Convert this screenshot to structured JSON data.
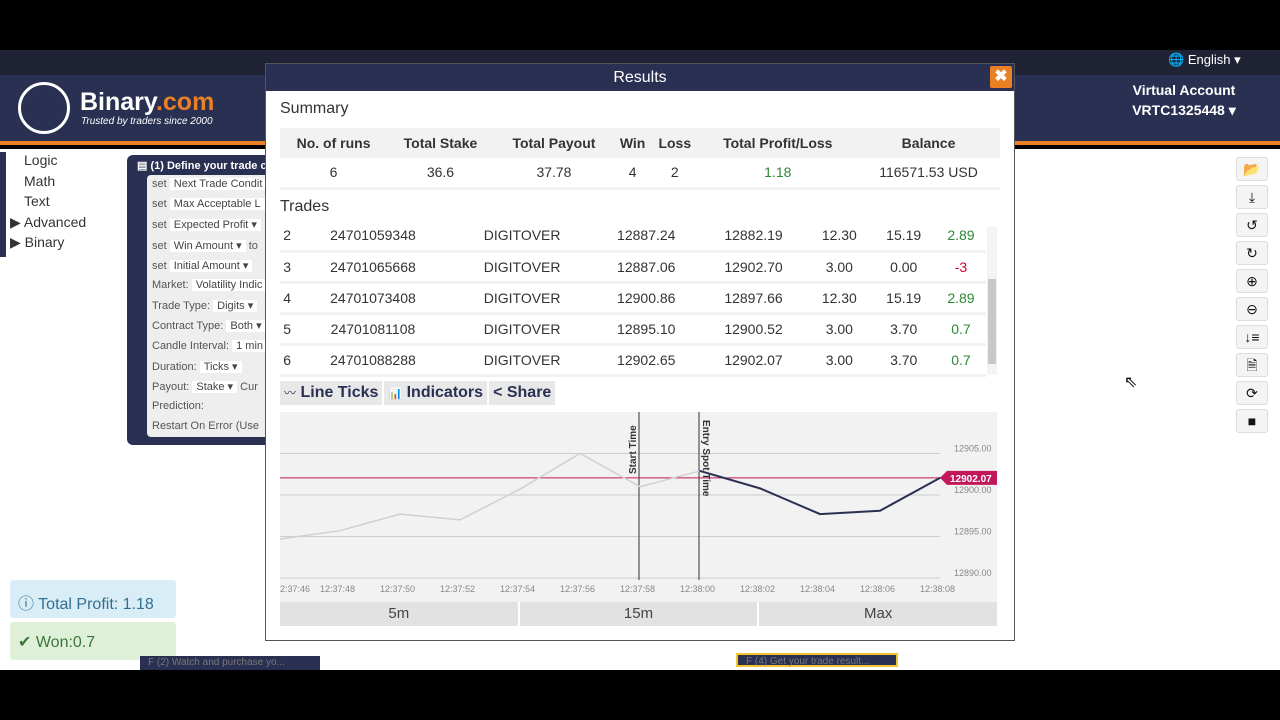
{
  "header": {
    "brand_main": "Binary",
    "brand_accent": ".com",
    "tagline": "Trusted by traders since 2000",
    "language": "English",
    "account_type": "Virtual Account",
    "account_id": "VRTC1325448"
  },
  "toolbox": {
    "items": [
      "Logic",
      "Math",
      "Text",
      "Advanced",
      "Binary"
    ]
  },
  "block": {
    "title": "(1) Define your trade c",
    "rows": [
      [
        "set",
        "Next Trade Condit"
      ],
      [
        "set",
        "Max Acceptable L"
      ],
      [
        "set",
        "Expected Profit ▾"
      ],
      [
        "set",
        "Win Amount ▾",
        "to"
      ],
      [
        "set",
        "Initial Amount ▾"
      ],
      [
        "Market:",
        "Volatility Indic"
      ],
      [
        "Trade Type:",
        "Digits ▾"
      ],
      [
        "Contract Type:",
        "Both ▾"
      ],
      [
        "Candle Interval:",
        "1 min"
      ],
      [
        "Duration:",
        "Ticks ▾"
      ],
      [
        "Payout:",
        "Stake ▾",
        "Cur"
      ],
      [
        "Prediction:"
      ],
      [
        "Restart On Error (Use"
      ]
    ]
  },
  "notifications": {
    "profit": "Total Profit: 1.18",
    "won": "Won:0.7"
  },
  "fblocks": {
    "watch": "F (2) Watch and purchase yo...",
    "result": "F (4) Get your trade result..."
  },
  "modal": {
    "title": "Results",
    "close": "✖",
    "summary_label": "Summary",
    "trades_label": "Trades",
    "summary_headers": [
      "No. of runs",
      "Total Stake",
      "Total Payout",
      "Win",
      "Loss",
      "Total Profit/Loss",
      "Balance"
    ],
    "summary_values": [
      "6",
      "36.6",
      "37.78",
      "4",
      "2",
      "1.18",
      "116571.53 USD"
    ],
    "trades": [
      [
        "2",
        "24701059348",
        "DIGITOVER",
        "12887.24",
        "12882.19",
        "12.30",
        "15.19",
        "2.89"
      ],
      [
        "3",
        "24701065668",
        "DIGITOVER",
        "12887.06",
        "12902.70",
        "3.00",
        "0.00",
        "-3"
      ],
      [
        "4",
        "24701073408",
        "DIGITOVER",
        "12900.86",
        "12897.66",
        "12.30",
        "15.19",
        "2.89"
      ],
      [
        "5",
        "24701081108",
        "DIGITOVER",
        "12895.10",
        "12900.52",
        "3.00",
        "3.70",
        "0.7"
      ],
      [
        "6",
        "24701088288",
        "DIGITOVER",
        "12902.65",
        "12902.07",
        "3.00",
        "3.70",
        "0.7"
      ]
    ],
    "chart_tools": [
      "Line Ticks",
      "Indicators",
      "Share"
    ],
    "ranges": [
      "5m",
      "15m",
      "Max"
    ]
  },
  "chart_data": {
    "type": "line",
    "x": [
      "12:37:46",
      "12:37:48",
      "12:37:50",
      "12:37:52",
      "12:37:54",
      "12:37:56",
      "12:37:58",
      "12:38:00",
      "12:38:02",
      "12:38:04",
      "12:38:06",
      "12:38:08"
    ],
    "x_tick_labels": [
      "2:37:46",
      "12:37:48",
      "12:37:50",
      "12:37:52",
      "12:37:54",
      "12:37:56",
      "12:37:58",
      "12:38:00",
      "12:38:02",
      "12:38:04",
      "12:38:06",
      "12:38:08"
    ],
    "values": [
      12894.7,
      12895.7,
      12897.7,
      12897.0,
      12900.7,
      12905.0,
      12901.0,
      12902.9,
      12900.8,
      12897.7,
      12898.1,
      12902.07
    ],
    "y_ticks": [
      "12905.00",
      "12900.00",
      "12895.00",
      "12890.00"
    ],
    "ylim": [
      12889,
      12910
    ],
    "current_price": "12902.07",
    "markers": [
      {
        "label": "Start Time",
        "x": "12:37:58"
      },
      {
        "label": "Entry Spot Time",
        "x": "12:38:00"
      }
    ],
    "grid": true,
    "colors": {
      "pre_entry": "#d0d0d0",
      "contract": "#2a3052",
      "current": "#c2185b"
    }
  },
  "toolbar": {
    "icons": [
      "open-folder-icon",
      "download-icon",
      "undo-icon",
      "redo-icon",
      "zoom-in-icon",
      "zoom-out-icon",
      "sort-icon",
      "log-icon",
      "reset-icon",
      "stop-icon"
    ]
  }
}
